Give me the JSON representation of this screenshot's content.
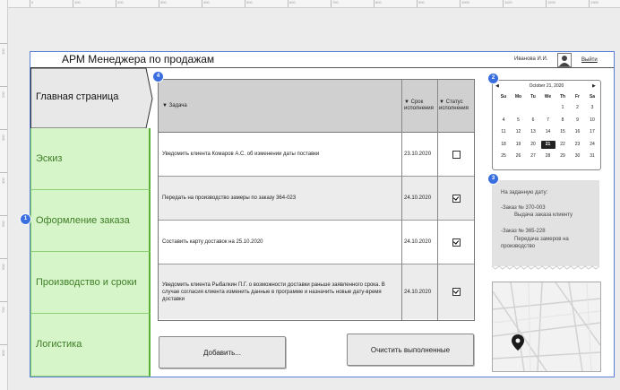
{
  "ruler": {
    "x_ticks": [
      "0",
      "100",
      "200",
      "300",
      "400",
      "500",
      "600",
      "700",
      "800",
      "900",
      "1000",
      "1100",
      "1200",
      "1300"
    ],
    "y_ticks": [
      "100",
      "200",
      "300",
      "400",
      "500",
      "600",
      "700",
      "800"
    ]
  },
  "header": {
    "title": "АРМ Менеджера по продажам",
    "user": "Иванова И.И.",
    "logout": "Выйти"
  },
  "sidebar": {
    "items": [
      {
        "label": "Главная страница"
      },
      {
        "label": "Эскиз"
      },
      {
        "label": "Оформление заказа"
      },
      {
        "label": "Производство и сроки"
      },
      {
        "label": "Логистика"
      }
    ]
  },
  "badges": {
    "sidebar": "1",
    "calendar": "2",
    "note": "3",
    "table": "4"
  },
  "table": {
    "columns": [
      "▼ Задача",
      "▼ Срок исполнения",
      "▼ Статус исполнения"
    ],
    "rows": [
      {
        "task": "Уведомить клиента Комаров А.С. об изменении даты поставки",
        "due": "23.10.2020",
        "done": false
      },
      {
        "task": "Передать на производство замеры по заказу 364-023",
        "due": "24.10.2020",
        "done": true
      },
      {
        "task": "Составить карту доставок на 25.10.2020",
        "due": "24.10.2020",
        "done": true
      },
      {
        "task": "Уведомить клиента Рыбалкин П.Г. о возможности доставки раньше заявленного срока. В случае согласия клиента изменить данные в программе и назначить новые дату-время доставки",
        "due": "24.10.2020",
        "done": true
      }
    ]
  },
  "buttons": {
    "add": "Добавить...",
    "clear": "Очистить выполненные"
  },
  "calendar": {
    "title": "October 21, 2020",
    "prev": "◀",
    "next": "▶",
    "weekdays": [
      "Su",
      "Mo",
      "Tu",
      "We",
      "Th",
      "Fr",
      "Sa"
    ],
    "weeks": [
      [
        "",
        "",
        "",
        "",
        "1",
        "2",
        "3"
      ],
      [
        "4",
        "5",
        "6",
        "7",
        "8",
        "9",
        "10"
      ],
      [
        "11",
        "12",
        "13",
        "14",
        "15",
        "16",
        "17"
      ],
      [
        "18",
        "19",
        "20",
        "21",
        "22",
        "23",
        "24"
      ],
      [
        "25",
        "26",
        "27",
        "28",
        "29",
        "30",
        "31"
      ]
    ],
    "selected": "21"
  },
  "note": {
    "heading": "На заданную дату:",
    "order1": "-Заказ № 370-003",
    "order1_detail": "Выдача заказа клиенту",
    "order2": "-Заказ № 365-228",
    "order2_detail": "Передача замеров на",
    "order2_detail2": "производство"
  },
  "colors": {
    "accent": "#3b6fe0",
    "nav_green": "#d6f5c9",
    "nav_text": "#3f7d27"
  }
}
